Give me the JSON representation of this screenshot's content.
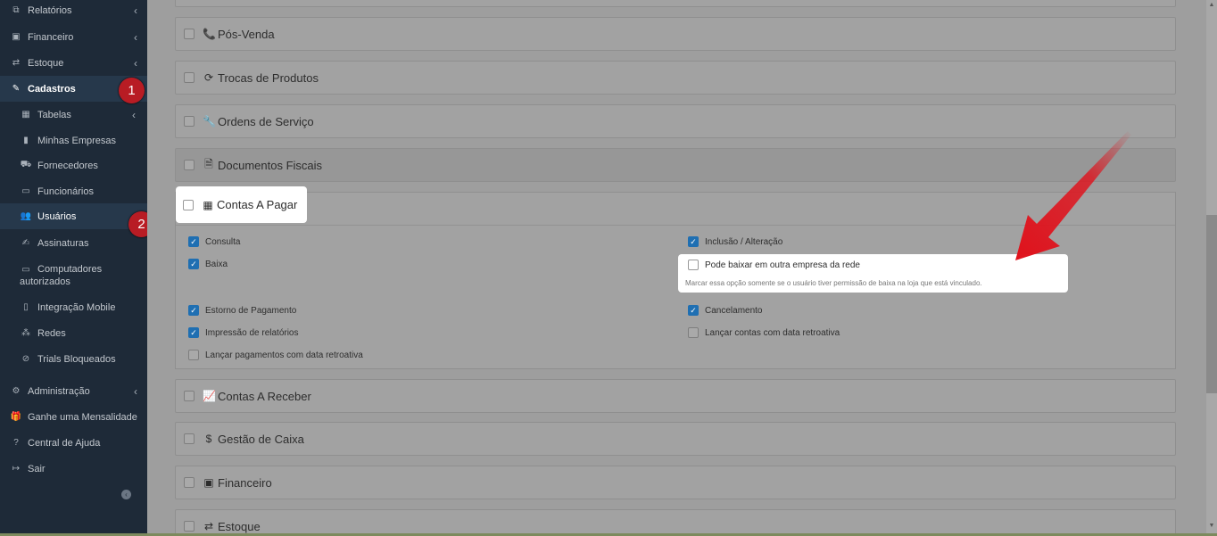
{
  "sidebar": {
    "items": [
      {
        "label": "Relatórios",
        "icon": "reports-icon"
      },
      {
        "label": "Financeiro",
        "icon": "money-icon"
      },
      {
        "label": "Estoque",
        "icon": "exchange-icon"
      },
      {
        "label": "Cadastros",
        "icon": "edit-icon"
      },
      {
        "label": "Tabelas",
        "icon": "table-icon"
      },
      {
        "label": "Minhas Empresas",
        "icon": "building-icon"
      },
      {
        "label": "Fornecedores",
        "icon": "truck-icon"
      },
      {
        "label": "Funcionários",
        "icon": "folder-icon"
      },
      {
        "label": "Usuários",
        "icon": "users-icon"
      },
      {
        "label": "Assinaturas",
        "icon": "signature-icon"
      },
      {
        "label_1": "Computadores",
        "label_2": "autorizados",
        "icon": "desktop-icon"
      },
      {
        "label": "Integração Mobile",
        "icon": "mobile-icon"
      },
      {
        "label": "Redes",
        "icon": "network-icon"
      },
      {
        "label": "Trials Bloqueados",
        "icon": "block-icon"
      },
      {
        "label": "Administração",
        "icon": "cogs-icon"
      },
      {
        "label": "Ganhe uma Mensalidade",
        "icon": "gift-icon"
      },
      {
        "label": "Central de Ajuda",
        "icon": "help-icon"
      },
      {
        "label": "Sair",
        "icon": "logout-icon"
      }
    ]
  },
  "badges": {
    "one": "1",
    "two": "2"
  },
  "panels": {
    "pos_venda": "Pós-Venda",
    "trocas": "Trocas de Produtos",
    "ordens": "Ordens de Serviço",
    "documentos": "Documentos Fiscais",
    "contas_pagar": "Contas A Pagar",
    "contas_receber": "Contas A Receber",
    "gestao_caixa": "Gestão de Caixa",
    "financeiro": "Financeiro",
    "estoque": "Estoque"
  },
  "options": {
    "consulta": {
      "label": "Consulta",
      "checked": true
    },
    "inclusao": {
      "label": "Inclusão / Alteração",
      "checked": true
    },
    "baixa": {
      "label": "Baixa",
      "checked": true
    },
    "pode_baixar": {
      "label": "Pode baixar em outra empresa da rede",
      "checked": false,
      "hint": "Marcar essa opção somente se o usuário tiver permissão de baixa na loja que está vinculado."
    },
    "estorno": {
      "label": "Estorno de Pagamento",
      "checked": true
    },
    "cancelamento": {
      "label": "Cancelamento",
      "checked": true
    },
    "impressao": {
      "label": "Impressão de relatórios",
      "checked": true
    },
    "lancar_contas": {
      "label": "Lançar contas com data retroativa",
      "checked": false
    },
    "lancar_pagamentos": {
      "label": "Lançar pagamentos com data retroativa",
      "checked": false
    }
  },
  "colors": {
    "accent_check": "#1f6fb2",
    "badge": "#b81c24",
    "arrow": "#e0111b",
    "sidebar_bg": "#1e2a38"
  }
}
